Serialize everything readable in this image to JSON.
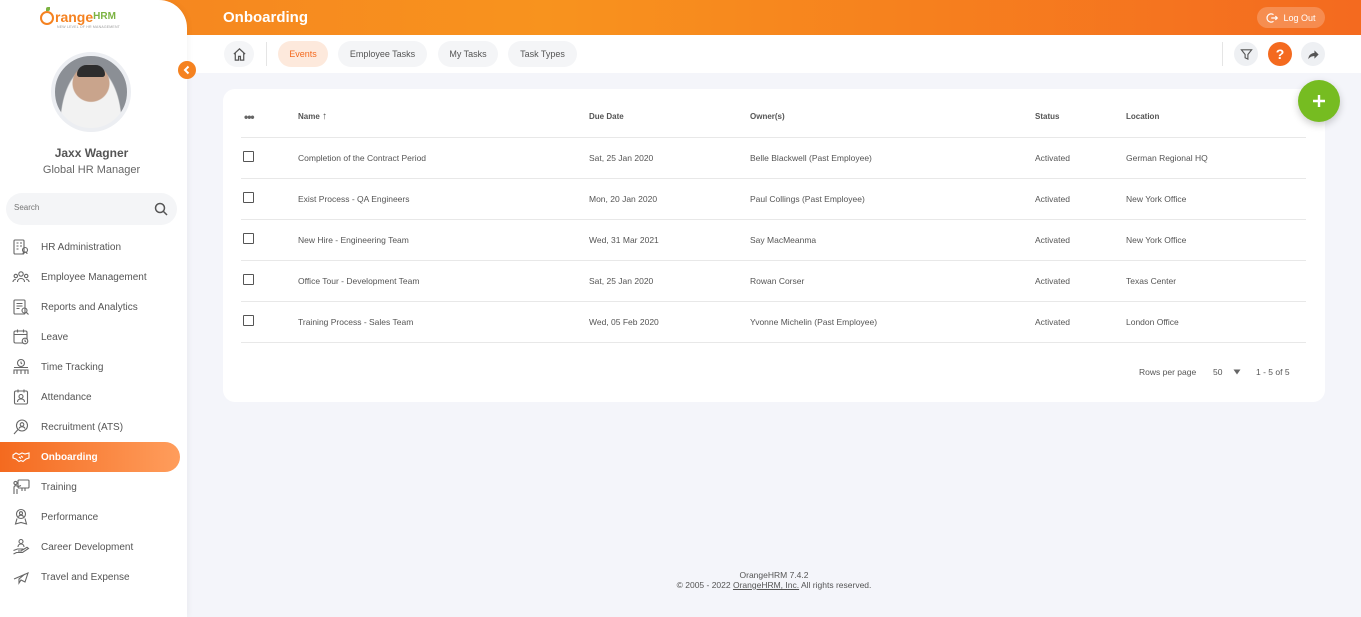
{
  "app": {
    "logo_main": "range",
    "logo_suffix": "HRM",
    "logo_tagline": "NEW LEVEL OF HR MANAGEMENT"
  },
  "header": {
    "title": "Onboarding",
    "logout_label": "Log Out"
  },
  "user": {
    "name": "Jaxx Wagner",
    "role": "Global HR Manager"
  },
  "sidebar": {
    "search_placeholder": "Search",
    "items": [
      {
        "label": "HR Administration",
        "icon": "hr-admin-icon"
      },
      {
        "label": "Employee Management",
        "icon": "employee-management-icon"
      },
      {
        "label": "Reports and Analytics",
        "icon": "reports-icon"
      },
      {
        "label": "Leave",
        "icon": "leave-icon"
      },
      {
        "label": "Time Tracking",
        "icon": "time-tracking-icon"
      },
      {
        "label": "Attendance",
        "icon": "attendance-icon"
      },
      {
        "label": "Recruitment (ATS)",
        "icon": "recruitment-icon"
      },
      {
        "label": "Onboarding",
        "icon": "onboarding-icon",
        "active": true
      },
      {
        "label": "Training",
        "icon": "training-icon"
      },
      {
        "label": "Performance",
        "icon": "performance-icon"
      },
      {
        "label": "Career Development",
        "icon": "career-icon"
      },
      {
        "label": "Travel and Expense",
        "icon": "travel-icon"
      }
    ]
  },
  "subnav": {
    "tabs": [
      {
        "label": "Events",
        "active": true
      },
      {
        "label": "Employee Tasks"
      },
      {
        "label": "My Tasks"
      },
      {
        "label": "Task Types"
      }
    ],
    "help_glyph": "?"
  },
  "table": {
    "columns": {
      "name": "Name",
      "due_date": "Due Date",
      "owners": "Owner(s)",
      "status": "Status",
      "location": "Location"
    },
    "sort_glyph": "↑",
    "rows": [
      {
        "name": "Completion of the Contract Period",
        "due_date": "Sat, 25 Jan 2020",
        "owners": "Belle Blackwell (Past Employee)",
        "status": "Activated",
        "location": "German Regional HQ"
      },
      {
        "name": "Exist Process - QA Engineers",
        "due_date": "Mon, 20 Jan 2020",
        "owners": "Paul Collings (Past Employee)",
        "status": "Activated",
        "location": "New York Office"
      },
      {
        "name": "New Hire - Engineering Team",
        "due_date": "Wed, 31 Mar 2021",
        "owners": "Say MacMeanma",
        "status": "Activated",
        "location": "New York Office"
      },
      {
        "name": "Office Tour - Development Team",
        "due_date": "Sat, 25 Jan 2020",
        "owners": "Rowan Corser",
        "status": "Activated",
        "location": "Texas Center"
      },
      {
        "name": "Training Process - Sales Team",
        "due_date": "Wed, 05 Feb 2020",
        "owners": "Yvonne Michelin (Past Employee)",
        "status": "Activated",
        "location": "London Office"
      }
    ]
  },
  "pagination": {
    "rows_per_page_label": "Rows per page",
    "rows_per_page_value": "50",
    "range": "1 - 5 of 5"
  },
  "footer": {
    "version": "OrangeHRM 7.4.2",
    "copyright_prefix": "© 2005 - 2022 ",
    "company_link": "OrangeHRM, Inc.",
    "copyright_suffix": " All rights reserved."
  },
  "colors": {
    "brand_orange": "#f58220",
    "brand_green": "#76bc21"
  }
}
